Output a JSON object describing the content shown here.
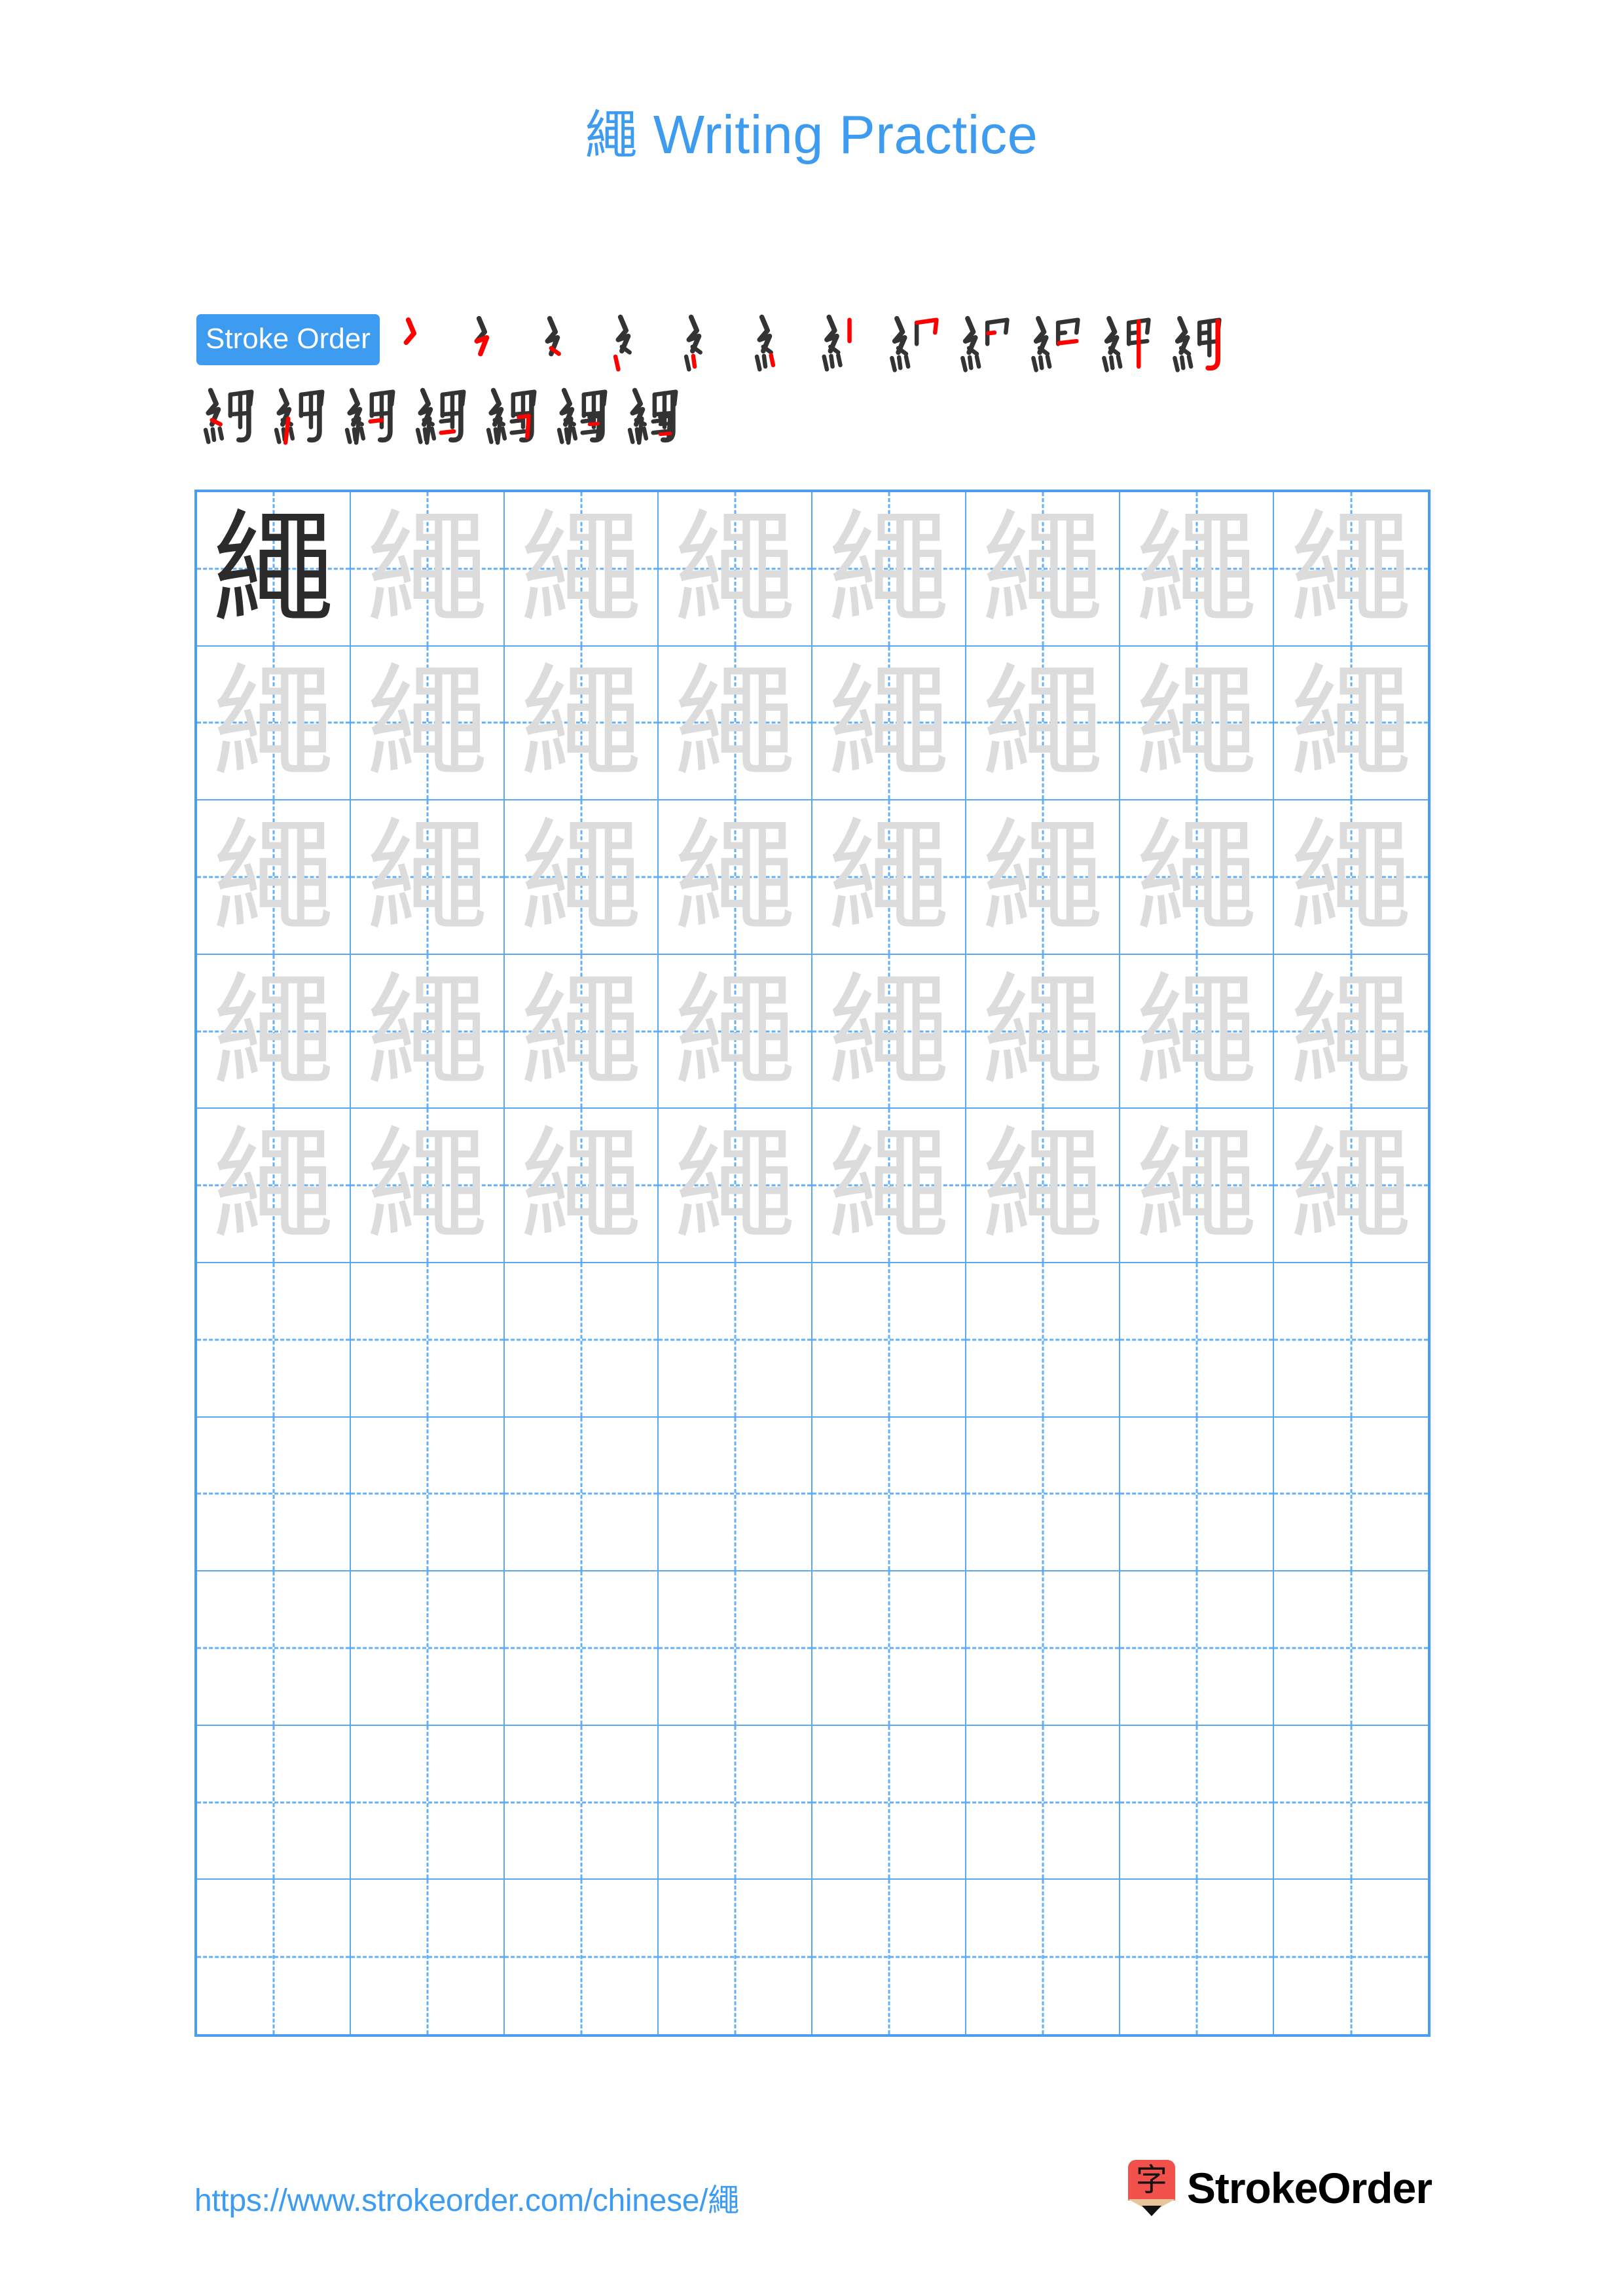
{
  "page": {
    "character": "繩",
    "background_color": "#ffffff",
    "accent_color": "#3d9bf0",
    "grid_line_color": "#4a9df0",
    "guide_line_color": "#63b0f5",
    "trace_char_color": "#dcdcdc",
    "solid_char_color": "#2b2b2b",
    "stroke_highlight_color": "#ff0000",
    "stroke_base_color": "#333333"
  },
  "title": {
    "character": "繩",
    "text": " Writing Practice",
    "full": "繩 Writing Practice"
  },
  "stroke_order": {
    "badge_label": "Stroke Order",
    "total_strokes": 19,
    "rows": [
      {
        "count": 12,
        "steps": [
          1,
          2,
          3,
          4,
          5,
          6,
          7,
          8,
          9,
          10,
          11,
          12
        ]
      },
      {
        "count": 7,
        "steps": [
          13,
          14,
          15,
          16,
          17,
          18,
          19
        ]
      }
    ]
  },
  "grid": {
    "columns": 8,
    "rows": 10,
    "cell_size_px": 236,
    "filled_rows": 5,
    "first_cell_is_solid": true,
    "cells": [
      [
        "繩",
        "繩",
        "繩",
        "繩",
        "繩",
        "繩",
        "繩",
        "繩"
      ],
      [
        "繩",
        "繩",
        "繩",
        "繩",
        "繩",
        "繩",
        "繩",
        "繩"
      ],
      [
        "繩",
        "繩",
        "繩",
        "繩",
        "繩",
        "繩",
        "繩",
        "繩"
      ],
      [
        "繩",
        "繩",
        "繩",
        "繩",
        "繩",
        "繩",
        "繩",
        "繩"
      ],
      [
        "繩",
        "繩",
        "繩",
        "繩",
        "繩",
        "繩",
        "繩",
        "繩"
      ],
      [
        "",
        "",
        "",
        "",
        "",
        "",
        "",
        ""
      ],
      [
        "",
        "",
        "",
        "",
        "",
        "",
        "",
        ""
      ],
      [
        "",
        "",
        "",
        "",
        "",
        "",
        "",
        ""
      ],
      [
        "",
        "",
        "",
        "",
        "",
        "",
        "",
        ""
      ],
      [
        "",
        "",
        "",
        "",
        "",
        "",
        "",
        ""
      ]
    ]
  },
  "footer": {
    "url": "https://www.strokeorder.com/chinese/繩",
    "brand_name": "StrokeOrder",
    "logo_glyph": "字",
    "logo_color": "#f2504b"
  }
}
